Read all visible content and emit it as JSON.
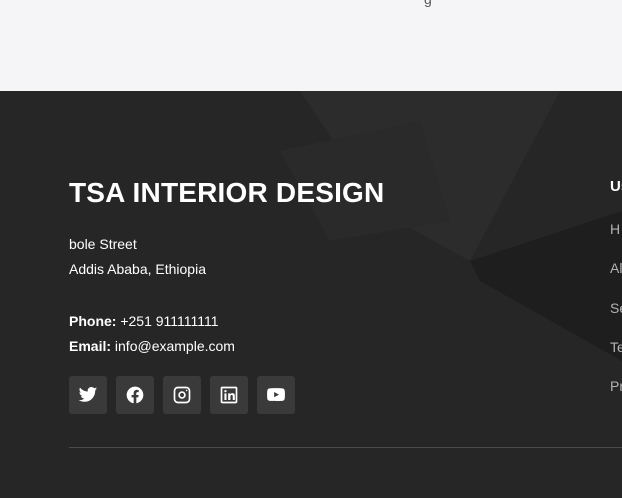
{
  "top": {
    "fragment": "g"
  },
  "footer": {
    "brand": "TSA INTERIOR DESIGN",
    "address": {
      "line1": "bole Street",
      "line2": "Addis Ababa, Ethiopia"
    },
    "contact": {
      "phone_label": "Phone:",
      "phone": "+251 911111111",
      "email_label": "Email:",
      "email": "info@example.com"
    },
    "social": [
      {
        "icon": "twitter-icon"
      },
      {
        "icon": "facebook-icon"
      },
      {
        "icon": "instagram-icon"
      },
      {
        "icon": "linkedin-icon"
      },
      {
        "icon": "youtube-icon"
      }
    ],
    "links_heading": "Us",
    "links": [
      "H",
      "Al",
      "Se",
      "Te",
      "Pr"
    ]
  },
  "colors": {
    "footer_bg": "#262626",
    "social_bg": "#3a3a3a",
    "top_bg": "#f5f5f7"
  }
}
